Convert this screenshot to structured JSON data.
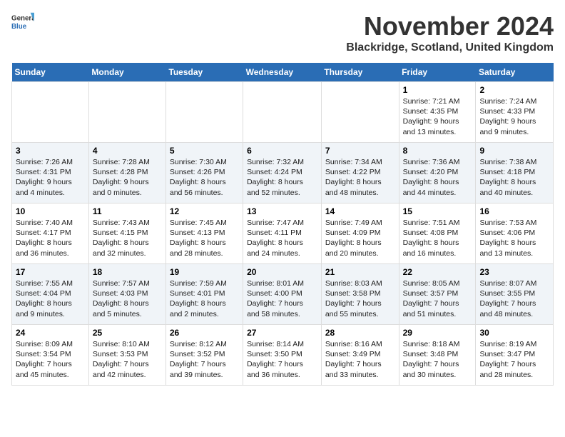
{
  "header": {
    "logo_line1": "General",
    "logo_line2": "Blue",
    "month_year": "November 2024",
    "location": "Blackridge, Scotland, United Kingdom"
  },
  "weekdays": [
    "Sunday",
    "Monday",
    "Tuesday",
    "Wednesday",
    "Thursday",
    "Friday",
    "Saturday"
  ],
  "weeks": [
    [
      {
        "day": "",
        "info": ""
      },
      {
        "day": "",
        "info": ""
      },
      {
        "day": "",
        "info": ""
      },
      {
        "day": "",
        "info": ""
      },
      {
        "day": "",
        "info": ""
      },
      {
        "day": "1",
        "info": "Sunrise: 7:21 AM\nSunset: 4:35 PM\nDaylight: 9 hours and 13 minutes."
      },
      {
        "day": "2",
        "info": "Sunrise: 7:24 AM\nSunset: 4:33 PM\nDaylight: 9 hours and 9 minutes."
      }
    ],
    [
      {
        "day": "3",
        "info": "Sunrise: 7:26 AM\nSunset: 4:31 PM\nDaylight: 9 hours and 4 minutes."
      },
      {
        "day": "4",
        "info": "Sunrise: 7:28 AM\nSunset: 4:28 PM\nDaylight: 9 hours and 0 minutes."
      },
      {
        "day": "5",
        "info": "Sunrise: 7:30 AM\nSunset: 4:26 PM\nDaylight: 8 hours and 56 minutes."
      },
      {
        "day": "6",
        "info": "Sunrise: 7:32 AM\nSunset: 4:24 PM\nDaylight: 8 hours and 52 minutes."
      },
      {
        "day": "7",
        "info": "Sunrise: 7:34 AM\nSunset: 4:22 PM\nDaylight: 8 hours and 48 minutes."
      },
      {
        "day": "8",
        "info": "Sunrise: 7:36 AM\nSunset: 4:20 PM\nDaylight: 8 hours and 44 minutes."
      },
      {
        "day": "9",
        "info": "Sunrise: 7:38 AM\nSunset: 4:18 PM\nDaylight: 8 hours and 40 minutes."
      }
    ],
    [
      {
        "day": "10",
        "info": "Sunrise: 7:40 AM\nSunset: 4:17 PM\nDaylight: 8 hours and 36 minutes."
      },
      {
        "day": "11",
        "info": "Sunrise: 7:43 AM\nSunset: 4:15 PM\nDaylight: 8 hours and 32 minutes."
      },
      {
        "day": "12",
        "info": "Sunrise: 7:45 AM\nSunset: 4:13 PM\nDaylight: 8 hours and 28 minutes."
      },
      {
        "day": "13",
        "info": "Sunrise: 7:47 AM\nSunset: 4:11 PM\nDaylight: 8 hours and 24 minutes."
      },
      {
        "day": "14",
        "info": "Sunrise: 7:49 AM\nSunset: 4:09 PM\nDaylight: 8 hours and 20 minutes."
      },
      {
        "day": "15",
        "info": "Sunrise: 7:51 AM\nSunset: 4:08 PM\nDaylight: 8 hours and 16 minutes."
      },
      {
        "day": "16",
        "info": "Sunrise: 7:53 AM\nSunset: 4:06 PM\nDaylight: 8 hours and 13 minutes."
      }
    ],
    [
      {
        "day": "17",
        "info": "Sunrise: 7:55 AM\nSunset: 4:04 PM\nDaylight: 8 hours and 9 minutes."
      },
      {
        "day": "18",
        "info": "Sunrise: 7:57 AM\nSunset: 4:03 PM\nDaylight: 8 hours and 5 minutes."
      },
      {
        "day": "19",
        "info": "Sunrise: 7:59 AM\nSunset: 4:01 PM\nDaylight: 8 hours and 2 minutes."
      },
      {
        "day": "20",
        "info": "Sunrise: 8:01 AM\nSunset: 4:00 PM\nDaylight: 7 hours and 58 minutes."
      },
      {
        "day": "21",
        "info": "Sunrise: 8:03 AM\nSunset: 3:58 PM\nDaylight: 7 hours and 55 minutes."
      },
      {
        "day": "22",
        "info": "Sunrise: 8:05 AM\nSunset: 3:57 PM\nDaylight: 7 hours and 51 minutes."
      },
      {
        "day": "23",
        "info": "Sunrise: 8:07 AM\nSunset: 3:55 PM\nDaylight: 7 hours and 48 minutes."
      }
    ],
    [
      {
        "day": "24",
        "info": "Sunrise: 8:09 AM\nSunset: 3:54 PM\nDaylight: 7 hours and 45 minutes."
      },
      {
        "day": "25",
        "info": "Sunrise: 8:10 AM\nSunset: 3:53 PM\nDaylight: 7 hours and 42 minutes."
      },
      {
        "day": "26",
        "info": "Sunrise: 8:12 AM\nSunset: 3:52 PM\nDaylight: 7 hours and 39 minutes."
      },
      {
        "day": "27",
        "info": "Sunrise: 8:14 AM\nSunset: 3:50 PM\nDaylight: 7 hours and 36 minutes."
      },
      {
        "day": "28",
        "info": "Sunrise: 8:16 AM\nSunset: 3:49 PM\nDaylight: 7 hours and 33 minutes."
      },
      {
        "day": "29",
        "info": "Sunrise: 8:18 AM\nSunset: 3:48 PM\nDaylight: 7 hours and 30 minutes."
      },
      {
        "day": "30",
        "info": "Sunrise: 8:19 AM\nSunset: 3:47 PM\nDaylight: 7 hours and 28 minutes."
      }
    ]
  ]
}
